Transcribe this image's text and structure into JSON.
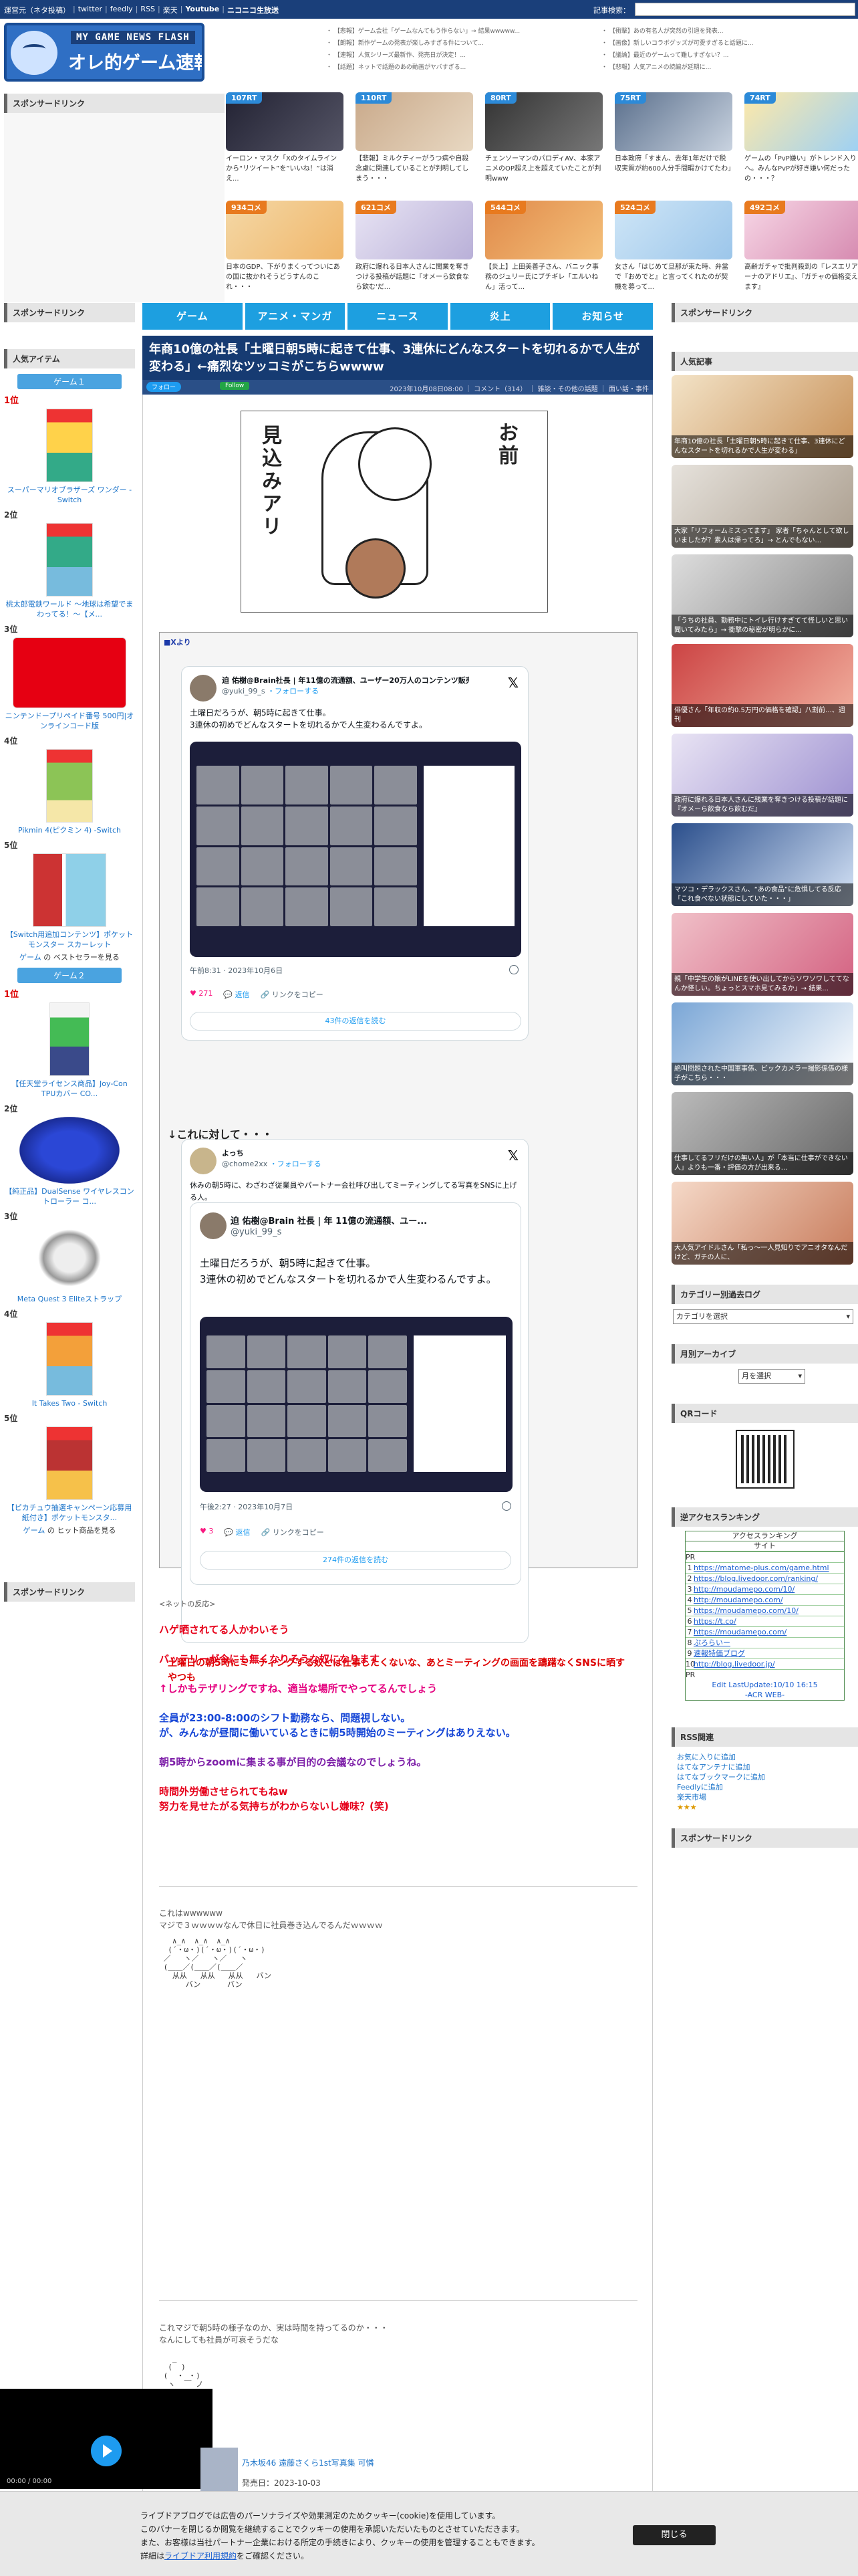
{
  "topbar": {
    "links": [
      "運営元（ネタ投稿）",
      "|",
      "twitter",
      "|",
      "feedly",
      "|",
      "RSS",
      "|",
      "楽天",
      "|",
      "Youtube",
      "|",
      "ニコニコ生放送"
    ],
    "search_label": "記事検索："
  },
  "header": {
    "logo_line1": "MY GAME NEWS FLASH",
    "logo_line2": "オレ的ゲーム速報@JIN",
    "links_col1": [
      "・ 【悲報】ゲーム会社「ゲームなんてもう作らない」→ 結果wwwww...",
      "・ 【朗報】新作ゲームの発表が楽しみすぎる件について...",
      "・ 【速報】人気シリーズ最新作、発売日が決定！...",
      "・ 【話題】ネットで話題のあの動画がヤバすぎる..."
    ],
    "links_col2": [
      "・ 【衝撃】あの有名人が突然の引退を発表...",
      "・ 【画像】新しいコラボグッズが可愛すぎると話題に...",
      "・ 【議論】最近のゲームって難しすぎない？...",
      "・ 【悲報】人気アニメの続編が延期に..."
    ]
  },
  "sidebar_left": {
    "sponsor_title": "スポンサードリンク",
    "sponsor_title_2": "スポンサードリンク",
    "popular_title": "人気アイテム",
    "game1_tab": "ゲーム１",
    "game2_tab": "ゲーム２",
    "game1_items": [
      {
        "rank": "1位",
        "name": "スーパーマリオブラザーズ ワンダー -Switch"
      },
      {
        "rank": "2位",
        "name": "桃太郎電鉄ワールド ～地球は希望でまわってる！～【メ..."
      },
      {
        "rank": "3位",
        "name": "ニンテンドープリペイド番号 500円|オンラインコード版"
      },
      {
        "rank": "4位",
        "name": "Pikmin 4(ピクミン 4) -Switch"
      },
      {
        "rank": "5位",
        "name": "【Switch用追加コンテンツ】ポケットモンスター スカーレット"
      }
    ],
    "game1_best": [
      "ゲーム",
      " の ベストセラーを見る"
    ],
    "game2_items": [
      {
        "rank": "1位",
        "name": "【任天堂ライセンス商品】Joy-Con TPUカバー CO..."
      },
      {
        "rank": "2位",
        "name": "【純正品】DualSense ワイヤレスコントローラー コ..."
      },
      {
        "rank": "3位",
        "name": "Meta Quest 3 Eliteストラップ"
      },
      {
        "rank": "4位",
        "name": "It Takes Two - Switch"
      },
      {
        "rank": "5位",
        "name": "【ピカチュウ抽選キャンペーン応募用紙付き】ポケットモンスタ..."
      }
    ],
    "game2_best": [
      "ゲーム",
      " の ヒット商品を見る"
    ]
  },
  "sponsor_top_title": "スポンサードリンク",
  "feed_row1": [
    {
      "badge": "107RT",
      "color": "#2c8ad8",
      "text": "イーロン・マスク「Xのタイムラインから“リツイート”を”いいね！”は消え..."
    },
    {
      "badge": "110RT",
      "color": "#2c8ad8",
      "text": "【悲報】ミルクティーがうつ病や自殺念慮に関連していることが判明してしまう・・・"
    },
    {
      "badge": "80RT",
      "color": "#2c8ad8",
      "text": "チェンソーマンのパロディAV、本家アニメのOP超え上を超えていたことが判明www"
    },
    {
      "badge": "75RT",
      "color": "#2c8ad8",
      "text": "日本政府「すまん、去年1年だけで税収実質が約600人分手間暇かけてたわ」"
    },
    {
      "badge": "74RT",
      "color": "#2c8ad8",
      "text": "ゲームの「PvP嫌い」がトレンド入りへ。みんなPvPが好き嫌い何だったの・・・？"
    }
  ],
  "feed_row2": [
    {
      "badge": "934コメ",
      "color": "#e87a1f",
      "text": "日本のGDP、下がりまくってついにあの国に抜かれそうどうすんのこれ・・・"
    },
    {
      "badge": "621コメ",
      "color": "#e87a1f",
      "text": "政府に爆れる日本人さんに聞業を奪きつける投稿が話題に『オメーら飲食なら飲む'だ..."
    },
    {
      "badge": "544コメ",
      "color": "#e87a1f",
      "text": "【炎上】上田美善子さん、バニック事務のジュリー氏にブチギレ「エルいねん」活って..."
    },
    {
      "badge": "524コメ",
      "color": "#e87a1f",
      "text": "女さん「はじめて旦那が束た時、弁當で『おめでと』と言ってくれたのが契機を募って..."
    },
    {
      "badge": "492コメ",
      "color": "#e87a1f",
      "text": "高齢ガチャで批判殺到の『レスエリアーナのアドリエ』、『ガチャの価格変えます』"
    }
  ],
  "nav": [
    "ゲーム",
    "アニメ・マンガ",
    "ニュース",
    "炎上",
    "お知らせ"
  ],
  "article": {
    "title": "年商10億の社長「土曜日朝5時に起きて仕事、3連休にどんなスタートを切れるかで人生が変わる」←痛烈なツッコミがこちらwwww",
    "follow_x": "フォロー",
    "follow_feedly": "Follow",
    "meta": "2023年10月08日08:00 ｜ コメント（314） ｜ 雑談・その他の話題 ｜ 面い話・事件",
    "manga_text1": "見込みアリ",
    "manga_text2": "お前",
    "from_x": "■Xより",
    "tweet1": {
      "name": "迫 佑樹@Brain社長 | 年11億の流通額、ユーザー20万人のコンテンツ販売プラットフォーム",
      "handle": "@yuki_99_s",
      "follow": "・フォローする",
      "text": [
        "土曜日だろうが、朝5時に起きて仕事。",
        "3連休の初めでどんなスタートを切れるかで人生変わるんですよ。"
      ],
      "time": "午前8:31 · 2023年10月6日",
      "likes": "271",
      "reply": "返信",
      "share": "リンクをコピー",
      "read": "43件の返信を読む"
    },
    "arrow_text": "↓これに対して・・・",
    "tweet2": {
      "name": "よっち",
      "handle": "@chome2xx",
      "follow": "・フォローする",
      "text": "休みの朝5時に、わざわざ従業員やパートナー会社呼び出してミーティングしてる写真をSNSに上げる人。",
      "q_name": "迫 佑樹@Brain 社長 | 年 11億の流通額、ユー...",
      "q_handle": "@yuki_99_s",
      "q_text": [
        "土曜日だろうが、朝5時に起きて仕事。",
        "3連休の初めでどんなスタートを切れるかで人生変わるんですよ。"
      ],
      "time": "午後2:27 · 2023年10月7日",
      "likes": "3",
      "reply": "返信",
      "share": "リンクをコピー",
      "read": "274件の返信を読む"
    },
    "red_note": "土曜日の朝5時にミーティングする奴とは仕事したくないな、あとミーティングの画面を躊躇なくSNSに晒すやつも",
    "reactions_lead": "<ネットの反応>",
    "reactions": [
      {
        "cls": "red",
        "lines": [
          "ハゲ晒されてる人かわいそう"
        ]
      },
      {
        "cls": "red",
        "lines": [
          "バッテリーが今にも無くなりそうな奴になります"
        ]
      },
      {
        "cls": "mag",
        "lines": [
          "↑しかもテザリングですね、適当な場所でやってるんでしょう"
        ]
      },
      {
        "cls": "blue",
        "lines": [
          "全員が23:00-8:00のシフト勤務なら、問題視しない。",
          "が、みんなが昼間に働いているときに朝5時開始のミーティングはありえない。"
        ]
      },
      {
        "cls": "pur",
        "lines": [
          "朝5時からzoomに集まる事が目的の会議なのでしょうね。"
        ]
      },
      {
        "cls": "red",
        "lines": [
          "時間外労働させられてもねw",
          "努力を見せたがる気持ちがわからないし嫌味？(笑)"
        ]
      }
    ],
    "aa1_text": [
      "これはwwwwww",
      "マジで３ｗｗｗｗなんで休日に社員巻き込んでるんだｗｗｗｗ"
    ],
    "aa1": "   ∧_∧  ∧_∧  ∧_∧\n  (´・ω・)(´・ω・)(´・ω・)\n ／   ヽ／   ヽ／   ヽ\n (＿＿／(＿＿／(＿＿／\n   从从   从从   从从   バン\n      バン      バン",
    "aa2_text": [
      "これマジで朝5時の様子なのか、実は時間を持ってるのか・・・",
      "なんにしても社員が可哀そうだな"
    ],
    "aa2": "   _\n  (  )\n (  ・ ・)\n  ヽ  ￣ ノ\n   |   |\n   |   |\n  /    \\"
  },
  "sidebar_right": {
    "sponsor_title": "スポンサードリンク",
    "popular_title": "人気記事",
    "popular": [
      {
        "text": "年商10億の社長「土曜日朝5時に起きて仕事、3連休にどんなスタートを切れるかで人生が変わる」"
      },
      {
        "text": "大家「リフォームミスってます」 家者「ちゃんとして欲しいましたが？素人は帰ってろ」→ とんでもない..."
      },
      {
        "text": "「うちの社員、勤務中にトイレ行けすぎてて怪しいと思い聞いてみたら」→ 衝撃の秘密が明らかに..."
      },
      {
        "text": "俳優さん「年収の約0.5万円の価格を確認」八割前…、週刊"
      },
      {
        "text": "政府に爆れる日本人さんに残業を奪きつける投稿が話題に『オメーら飲食なら飲むだ』"
      },
      {
        "text": "マツコ・デラックスさん、“あの食品”に危惧してる反応「これ食べない状態にしていた・・・」"
      },
      {
        "text": "親「中学生の娘がLINEを使い出してからソワソワしててなんか怪しい。ちょっとスマホ見てみるか」→ 結果..."
      },
      {
        "text": "絶叫問題された中国軍事係、ビックカメラー撮影係係の様子がこちら・・・"
      },
      {
        "text": "仕事してるフリだけの無い人」が「本当に仕事ができない人」よりも一番・評価の方が出来る..."
      },
      {
        "text": "大人気アイドルさん「私っ〜一人見知りでアニオタなんだけど、ガチの人に、"
      }
    ],
    "archive_cat_title": "カテゴリー別過去ログ",
    "archive_cat_select": "カテゴリを選択",
    "archive_month_title": "月別アーカイブ",
    "archive_month_select": "月を選択",
    "qr_title": "QRコード",
    "ranking_title": "逆アクセスランキング",
    "ranking_head": "アクセスランキング",
    "ranking_head2": "サイト",
    "ranking_pr": "PR",
    "ranking_rows": [
      {
        "n": "1",
        "u": "https://matome-plus.com/game.html"
      },
      {
        "n": "2",
        "u": "https://blog.livedoor.com/ranking/"
      },
      {
        "n": "3",
        "u": "http://moudamepo.com/10/"
      },
      {
        "n": "4",
        "u": "http://moudamepo.com/"
      },
      {
        "n": "5",
        "u": "https://moudamepo.com/10/"
      },
      {
        "n": "6",
        "u": "https://t.co/"
      },
      {
        "n": "7",
        "u": "https://moudamepo.com/"
      },
      {
        "n": "8",
        "u": "ぷろらいー"
      },
      {
        "n": "9",
        "u": "速報特価ブログ"
      },
      {
        "n": "10",
        "u": "http://blog.livedoor.jp/"
      }
    ],
    "ranking_pr2": "PR",
    "ranking_foot": "Edit LastUpdate:10/10 16:15",
    "ranking_foot2": "-ACR WEB-",
    "rss_title": "RSS関連",
    "rss_links": [
      "お気に入りに追加",
      "はてなアンテナに追加",
      "はてなブックマークに追加",
      "Feedlyに追加",
      "楽天市場"
    ],
    "sponsor_title_2": "スポンサードリンク"
  },
  "book": {
    "title": "乃木坂46 遠藤さくら1st写真集 可憐",
    "date": "発売日：2023-10-03"
  },
  "video": {
    "time": "00:00 / 00:00"
  },
  "cookie": {
    "lines": [
      "ライブドアブログでは広告のパーソナライズや効果測定のためクッキー(cookie)を使用しています。",
      "このバナーを閉じるか閲覧を継続することでクッキーの使用を承認いただいたものとさせていただきます。",
      "また、お客様は当社パートナー企業における所定の手続きにより、クッキーの使用を管理することもできます。"
    ],
    "detail_pre": "詳細は",
    "detail_link": "ライブドア利用規約",
    "detail_post": "をご確認ください。",
    "close": "閉じる"
  }
}
